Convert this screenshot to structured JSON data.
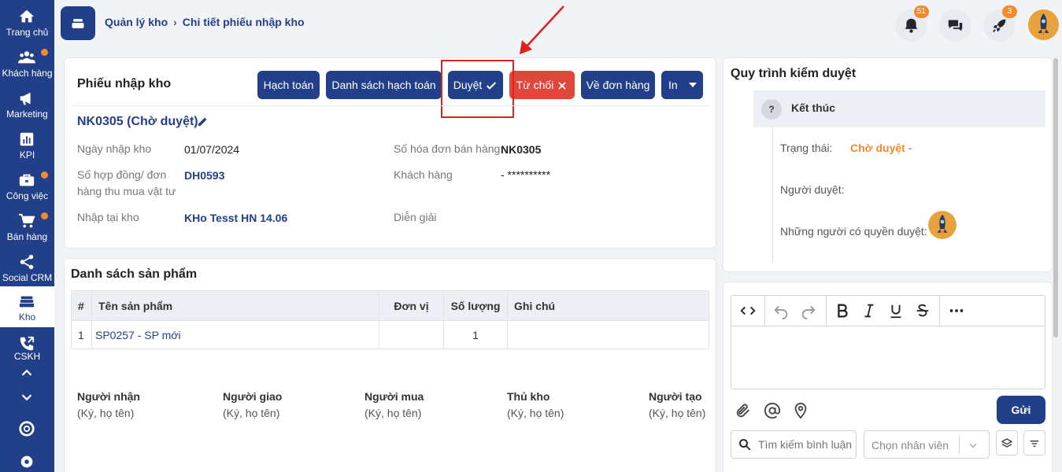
{
  "sidebar": {
    "items": [
      {
        "label": "Trang chủ",
        "icon": "home-icon"
      },
      {
        "label": "Khách hàng",
        "icon": "users-icon"
      },
      {
        "label": "Marketing",
        "icon": "megaphone-icon"
      },
      {
        "label": "KPI",
        "icon": "chart-icon"
      },
      {
        "label": "Công việc",
        "icon": "briefcase-icon"
      },
      {
        "label": "Bán hàng",
        "icon": "cart-icon"
      },
      {
        "label": "Social CRM",
        "icon": "share-icon"
      },
      {
        "label": "Kho",
        "icon": "warehouse-icon"
      },
      {
        "label": "CSKH",
        "icon": "phone-icon"
      }
    ]
  },
  "header": {
    "breadcrumb": [
      "Quản lý kho",
      "Chi tiết phiếu nhập kho"
    ],
    "notification_count": "51",
    "rocket_count": "3"
  },
  "receipt": {
    "title": "Phiếu nhập kho",
    "buttons": {
      "hach_toan": "Hạch toán",
      "ds_hach_toan": "Danh sách hạch toán",
      "duyet": "Duyệt",
      "tu_choi": "Từ chối",
      "ve_don_hang": "Về đơn hàng",
      "in": "In"
    },
    "doc_number": "NK0305 (Chờ duyệt)",
    "fields": {
      "ngay_nhap_kho_label": "Ngày nhập kho",
      "ngay_nhap_kho": "01/07/2024",
      "so_hoa_don_label": "Số hóa đơn bán hàng",
      "so_hoa_don": "NK0305",
      "so_hop_dong_label": "Số hợp đồng/ đơn hàng thu mua vật tư",
      "so_hop_dong": "DH0593",
      "khach_hang_label": "Khách hàng",
      "khach_hang": "- **********",
      "nhap_tai_kho_label": "Nhập tại kho",
      "nhap_tai_kho": "KHo Tesst HN 14.06",
      "dien_giai_label": "Diễn giải"
    }
  },
  "products": {
    "title": "Danh sách sản phẩm",
    "columns": [
      "#",
      "Tên sản phẩm",
      "Đơn vị",
      "Số lượng",
      "Ghi chú"
    ],
    "rows": [
      {
        "no": "1",
        "name": "SP0257 - SP mới",
        "unit": "",
        "qty": "1",
        "note": ""
      }
    ]
  },
  "signatures": [
    {
      "title": "Người nhận",
      "sub": "(Ký, họ tên)"
    },
    {
      "title": "Người giao",
      "sub": "(Ký, họ tên)"
    },
    {
      "title": "Người mua",
      "sub": "(Ký, họ tên)"
    },
    {
      "title": "Thủ kho",
      "sub": "(Ký, họ tên)"
    },
    {
      "title": "Người tạo",
      "sub": "(Ký, họ tên)"
    }
  ],
  "approval": {
    "title": "Quy trình kiểm duyệt",
    "qmark": "?",
    "step": "Kết thúc",
    "status_label": "Trạng thái:",
    "status_value": "Chờ duyệt -",
    "approver_label": "Người duyệt:",
    "permitted_label": "Những người có quyền duyệt:"
  },
  "comments": {
    "send_label": "Gửi",
    "search_placeholder": "Tìm kiếm bình luận",
    "employee_placeholder": "Chọn nhân viên"
  },
  "colors": {
    "primary": "#22408a",
    "danger": "#e0463a",
    "warning": "#f28a2e"
  }
}
